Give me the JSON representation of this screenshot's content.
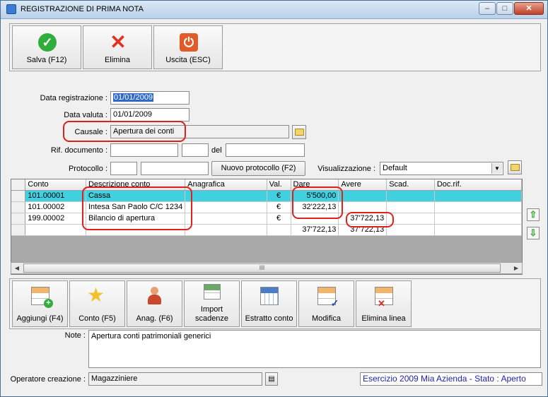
{
  "window": {
    "title": "REGISTRAZIONE DI PRIMA NOTA",
    "minimize_label": "–",
    "maximize_label": "□",
    "close_label": "✕"
  },
  "toolbar": {
    "save_label": "Salva (F12)",
    "delete_label": "Elimina",
    "exit_label": "Uscita (ESC)",
    "save_icon": "check-icon",
    "delete_icon": "cross-icon",
    "exit_icon": "power-icon"
  },
  "form": {
    "data_registrazione_label": "Data registrazione :",
    "data_registrazione_value": "01/01/2009",
    "data_valuta_label": "Data valuta :",
    "data_valuta_value": "01/01/2009",
    "causale_label": "Causale :",
    "causale_value": "Apertura dei conti",
    "rif_documento_label": "Rif. documento :",
    "rif_documento_value": "",
    "del_label": "del",
    "del_value": "",
    "protocollo_label": "Protocollo :",
    "protocollo_value": "",
    "nuovo_protocollo_label": "Nuovo protocollo (F2)",
    "visualizzazione_label": "Visualizzazione :",
    "visualizzazione_value": "Default"
  },
  "grid": {
    "columns": [
      "Conto",
      "Descrizione conto",
      "Anagrafica",
      "Val.",
      "Dare",
      "Avere",
      "Scad.",
      "Doc.rif."
    ],
    "rows": [
      [
        "101.00001",
        "Cassa",
        "",
        "€",
        "5'500,00",
        "",
        "",
        ""
      ],
      [
        "101.00002",
        "Intesa San Paolo C/C 1234",
        "",
        "€",
        "32'222,13",
        "",
        "",
        ""
      ],
      [
        "199.00002",
        "Bilancio di apertura",
        "",
        "€",
        "",
        "37'722,13",
        "",
        ""
      ]
    ],
    "totals": {
      "dare": "37'722,13",
      "avere": "37'722,13"
    },
    "scroll_thumb_label": "III"
  },
  "actions": {
    "aggiungi_label": "Aggiungi (F4)",
    "conto_label": "Conto (F5)",
    "anag_label": "Anag. (F6)",
    "import_label": "Import scadenze",
    "estratto_label": "Estratto conto",
    "modifica_label": "Modifica",
    "elimina_linea_label": "Elimina linea"
  },
  "note": {
    "label": "Note :",
    "value": "Apertura conti patrimoniali generici"
  },
  "footer": {
    "operatore_label": "Operatore creazione :",
    "operatore_value": "Magazziniere",
    "status_text": "Esercizio 2009 Mia Azienda - Stato : Aperto"
  },
  "colors": {
    "highlight_row": "#40d0e0",
    "annotation_red": "#e0201c",
    "status_text": "#2323a8"
  }
}
